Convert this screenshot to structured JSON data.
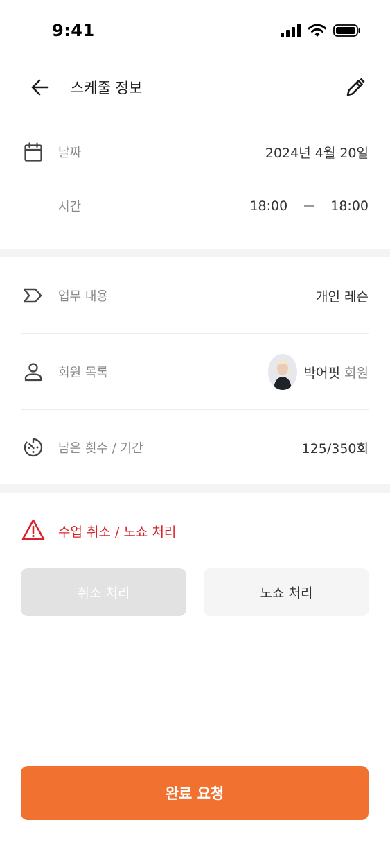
{
  "status_bar": {
    "time": "9:41"
  },
  "header": {
    "title": "스케줄 정보"
  },
  "schedule": {
    "date_label": "날짜",
    "date_value": "2024년 4월 20일",
    "time_label": "시간",
    "time_start": "18:00",
    "time_end": "18:00"
  },
  "details": {
    "task_label": "업무 내용",
    "task_value": "개인 레슨",
    "member_label": "회원 목록",
    "member_name": "박어핏",
    "member_suffix": "회원",
    "remaining_label": "남은 횟수 / 기간",
    "remaining_value": "125/350회"
  },
  "cancel_section": {
    "title": "수업 취소 / 노쇼 처리",
    "cancel_button": "취소 처리",
    "noshow_button": "노쇼 처리"
  },
  "footer": {
    "complete_button": "완료 요청"
  },
  "colors": {
    "accent": "#f07130",
    "warning": "#d8232a",
    "disabled_button": "#e2e2e2",
    "section_gap": "#f4f4f4"
  },
  "icons": [
    "back-arrow-icon",
    "pencil-icon",
    "calendar-icon",
    "tag-icon",
    "person-icon",
    "timer-icon",
    "warning-icon"
  ]
}
